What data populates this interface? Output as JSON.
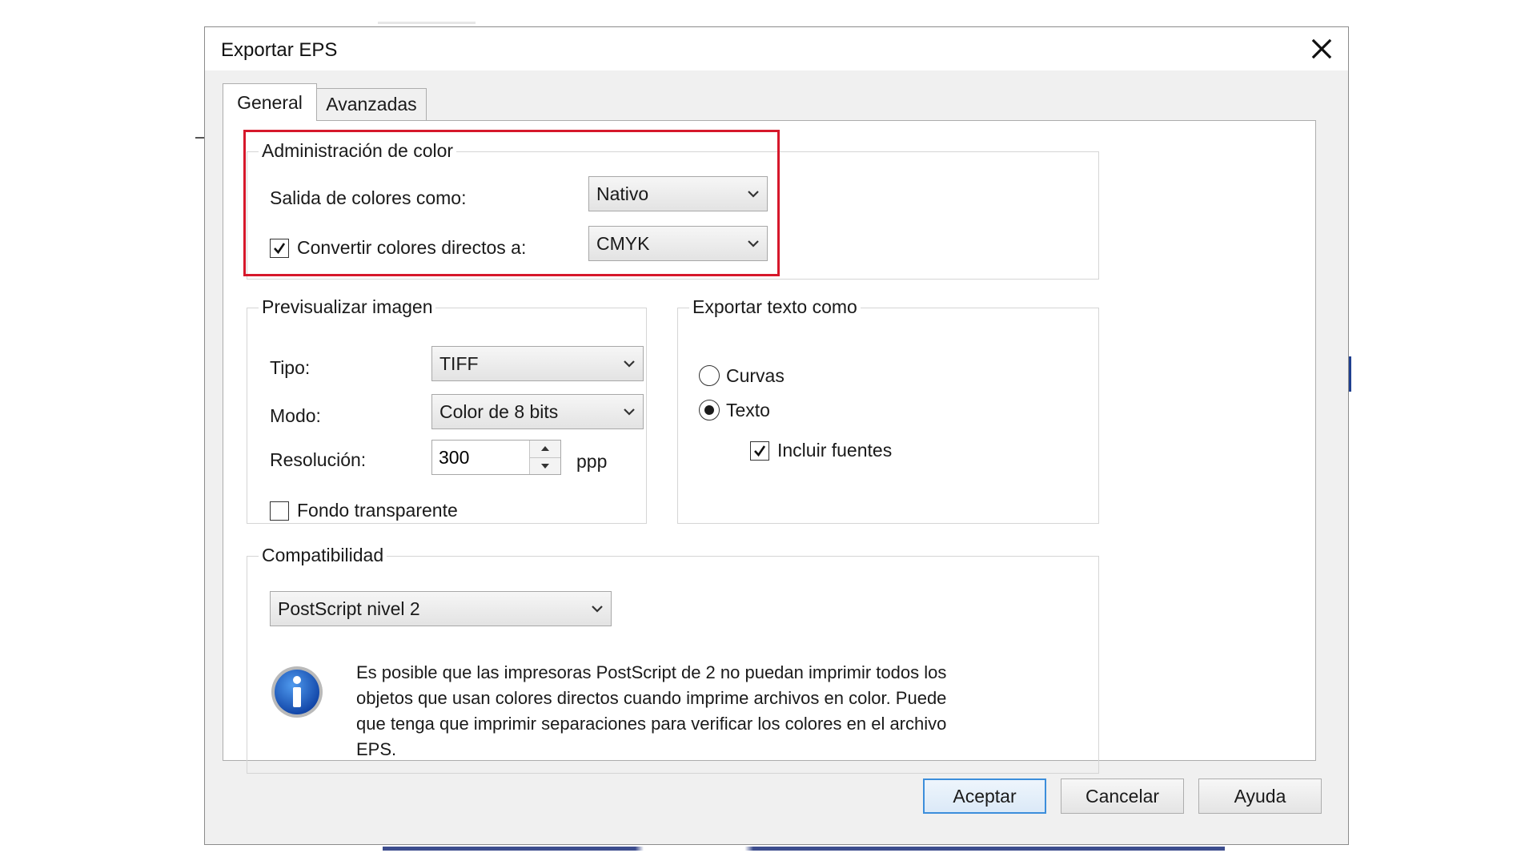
{
  "dialog": {
    "title": "Exportar EPS"
  },
  "tabs": [
    {
      "label": "General",
      "active": true
    },
    {
      "label": "Avanzadas",
      "active": false
    }
  ],
  "color_management": {
    "legend": "Administración de color",
    "output_label": "Salida de colores como:",
    "output_value": "Nativo",
    "convert_checked": true,
    "convert_label": "Convertir colores directos a:",
    "convert_value": "CMYK"
  },
  "preview": {
    "legend": "Previsualizar imagen",
    "type_label": "Tipo:",
    "type_value": "TIFF",
    "mode_label": "Modo:",
    "mode_value": "Color de 8 bits",
    "resolution_label": "Resolución:",
    "resolution_value": "300",
    "resolution_unit": "ppp",
    "transparent_checked": false,
    "transparent_label": "Fondo transparente"
  },
  "export_text": {
    "legend": "Exportar texto como",
    "curves_label": "Curvas",
    "curves_selected": false,
    "text_label": "Texto",
    "text_selected": true,
    "include_fonts_checked": true,
    "include_fonts_label": "Incluir fuentes"
  },
  "compatibility": {
    "legend": "Compatibilidad",
    "value": "PostScript nivel 2",
    "info_lines": [
      "Es posible que las impresoras PostScript de 2 no puedan imprimir todos los",
      "objetos que usan colores directos cuando imprime archivos en color. Puede",
      "que tenga que imprimir separaciones para verificar los colores en el archivo",
      "EPS."
    ]
  },
  "buttons": {
    "ok": "Aceptar",
    "cancel": "Cancelar",
    "help": "Ayuda"
  },
  "colors": {
    "highlight": "#d6182b",
    "primary_border": "#3c8edb",
    "info_icon": "#1f5fbf"
  },
  "icons": {
    "close": "close-icon",
    "dropdown": "chevron-down-icon",
    "check": "check-icon",
    "info": "info-icon",
    "spin_up": "arrow-up-icon",
    "spin_down": "arrow-down-icon"
  }
}
